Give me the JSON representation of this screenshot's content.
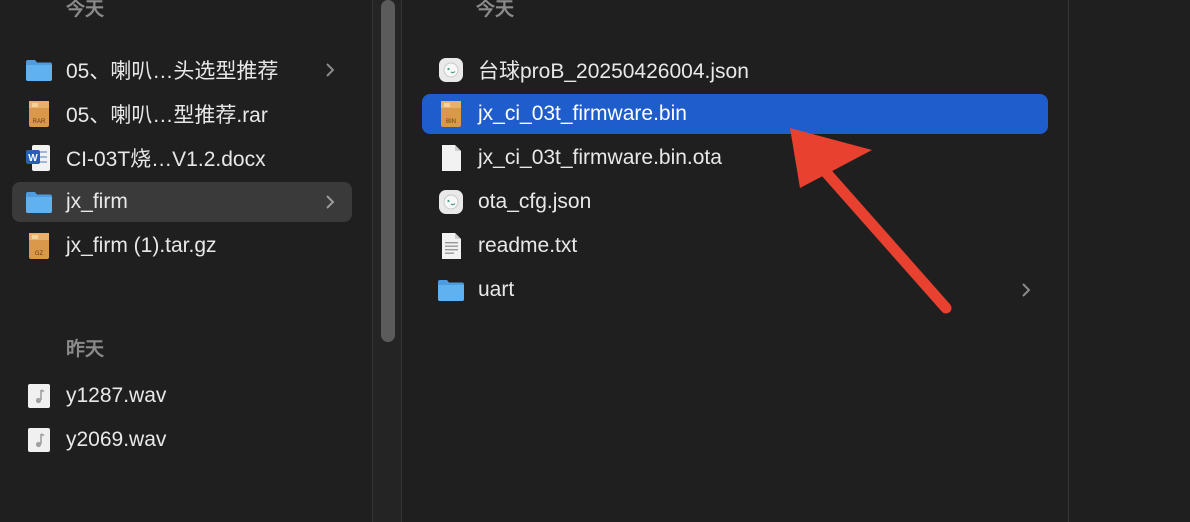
{
  "left_column": {
    "today_header": "今天",
    "yesterday_header": "昨天",
    "today_items": [
      {
        "label": "05、喇叭…头选型推荐",
        "icon": "folder-icon",
        "has_chevron": true
      },
      {
        "label": "05、喇叭…型推荐.rar",
        "icon": "rar-archive-icon",
        "has_chevron": false
      },
      {
        "label": "CI-03T烧…V1.2.docx",
        "icon": "word-document-icon",
        "has_chevron": false
      },
      {
        "label": "jx_firm",
        "icon": "folder-icon",
        "has_chevron": true,
        "selected": true
      },
      {
        "label": "jx_firm (1).tar.gz",
        "icon": "gz-archive-icon",
        "has_chevron": false
      }
    ],
    "yesterday_items": [
      {
        "label": "y1287.wav",
        "icon": "audio-file-icon"
      },
      {
        "label": "y2069.wav",
        "icon": "audio-file-icon"
      }
    ]
  },
  "right_column": {
    "today_header": "今天",
    "items": [
      {
        "label": "台球proB_20250426004.json",
        "icon": "json-file-icon",
        "has_chevron": false
      },
      {
        "label": "jx_ci_03t_firmware.bin",
        "icon": "bin-file-icon",
        "has_chevron": false,
        "selected": true
      },
      {
        "label": "jx_ci_03t_firmware.bin.ota",
        "icon": "blank-document-icon",
        "has_chevron": false
      },
      {
        "label": "ota_cfg.json",
        "icon": "json-file-icon",
        "has_chevron": false
      },
      {
        "label": "readme.txt",
        "icon": "text-document-icon",
        "has_chevron": false
      },
      {
        "label": "uart",
        "icon": "folder-icon",
        "has_chevron": true
      }
    ]
  },
  "icon_badges": {
    "rar": "RAR",
    "gz": "GZ",
    "bin": "BIN",
    "word": "W"
  },
  "colors": {
    "selection_active": "#1f5ccc",
    "selection_inactive": "#3a3a3a",
    "annotation_arrow": "#e8412f",
    "folder": "#5aa9e8"
  }
}
